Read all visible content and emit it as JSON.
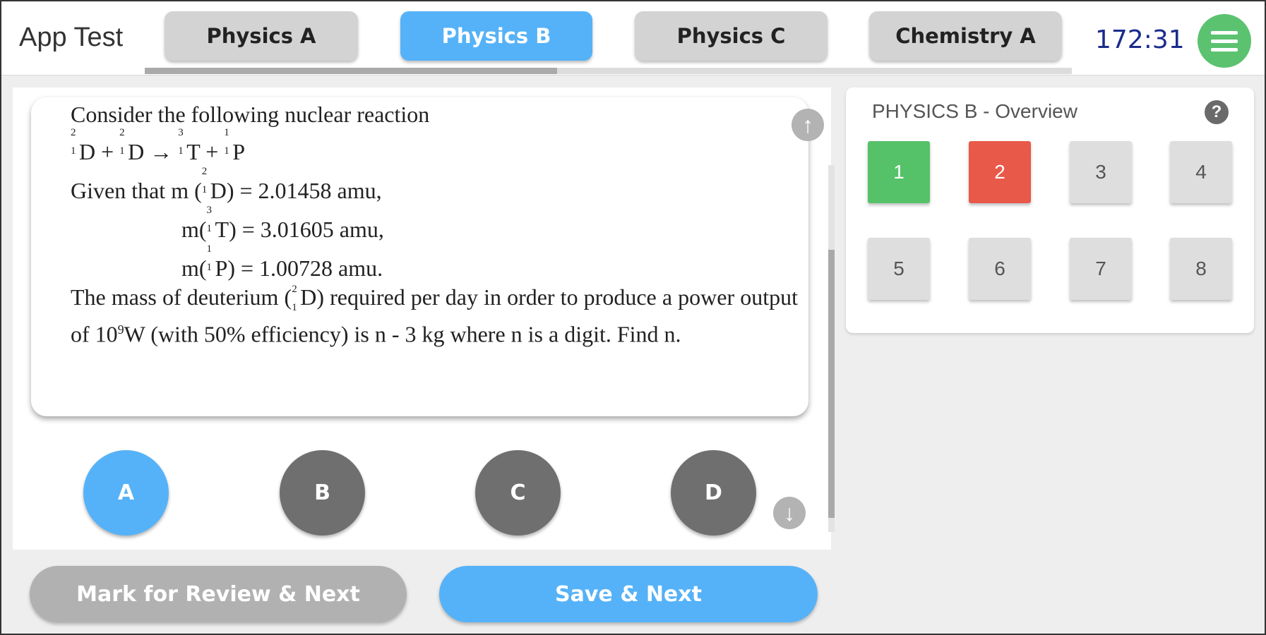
{
  "header": {
    "app_title": "App Test",
    "timer": "172:31",
    "tabs": [
      {
        "label": "Physics A",
        "active": false
      },
      {
        "label": "Physics B",
        "active": true
      },
      {
        "label": "Physics C",
        "active": false
      },
      {
        "label": "Chemistry A",
        "active": false
      }
    ],
    "menu_icon": "hamburger-menu-icon"
  },
  "question": {
    "line1": "Consider the following nuclear reaction",
    "reaction": {
      "D1": "D +",
      "D2": "D →",
      "T": "T +",
      "P": "P"
    },
    "given_prefix": "Given that m (",
    "given_D": "D) = 2.01458 amu,",
    "mass_T_prefix": "m(",
    "mass_T": "T) = 3.01605 amu,",
    "mass_P_prefix": "m(",
    "mass_P": "P) = 1.00728 amu.",
    "para_a": "The mass of deuterium (",
    "para_b": "D) required per day in order to produce a power output of 10",
    "para_exp": "9",
    "para_c": "W  (with 50% efficiency) is n - 3 kg where n is a digit. Find n.",
    "nuclide": {
      "mass2": "2",
      "mass3": "3",
      "mass1": "1",
      "charge1": "1"
    }
  },
  "options": [
    {
      "label": "A",
      "selected": true
    },
    {
      "label": "B",
      "selected": false
    },
    {
      "label": "C",
      "selected": false
    },
    {
      "label": "D",
      "selected": false
    }
  ],
  "actions": {
    "review_label": "Mark for Review & Next",
    "save_label": "Save & Next"
  },
  "overview": {
    "title": "PHYSICS B - Overview",
    "help": "?",
    "questions": [
      {
        "num": "1",
        "status": "answered"
      },
      {
        "num": "2",
        "status": "not-answered"
      },
      {
        "num": "3",
        "status": "not-visited"
      },
      {
        "num": "4",
        "status": "not-visited"
      },
      {
        "num": "5",
        "status": "not-visited"
      },
      {
        "num": "6",
        "status": "not-visited"
      },
      {
        "num": "7",
        "status": "not-visited"
      },
      {
        "num": "8",
        "status": "not-visited"
      }
    ]
  },
  "colors": {
    "accent": "#55b2f8",
    "answered": "#55c26a",
    "not_answered": "#e8594a",
    "menu": "#5bc270",
    "timer": "#1a2b8c"
  }
}
